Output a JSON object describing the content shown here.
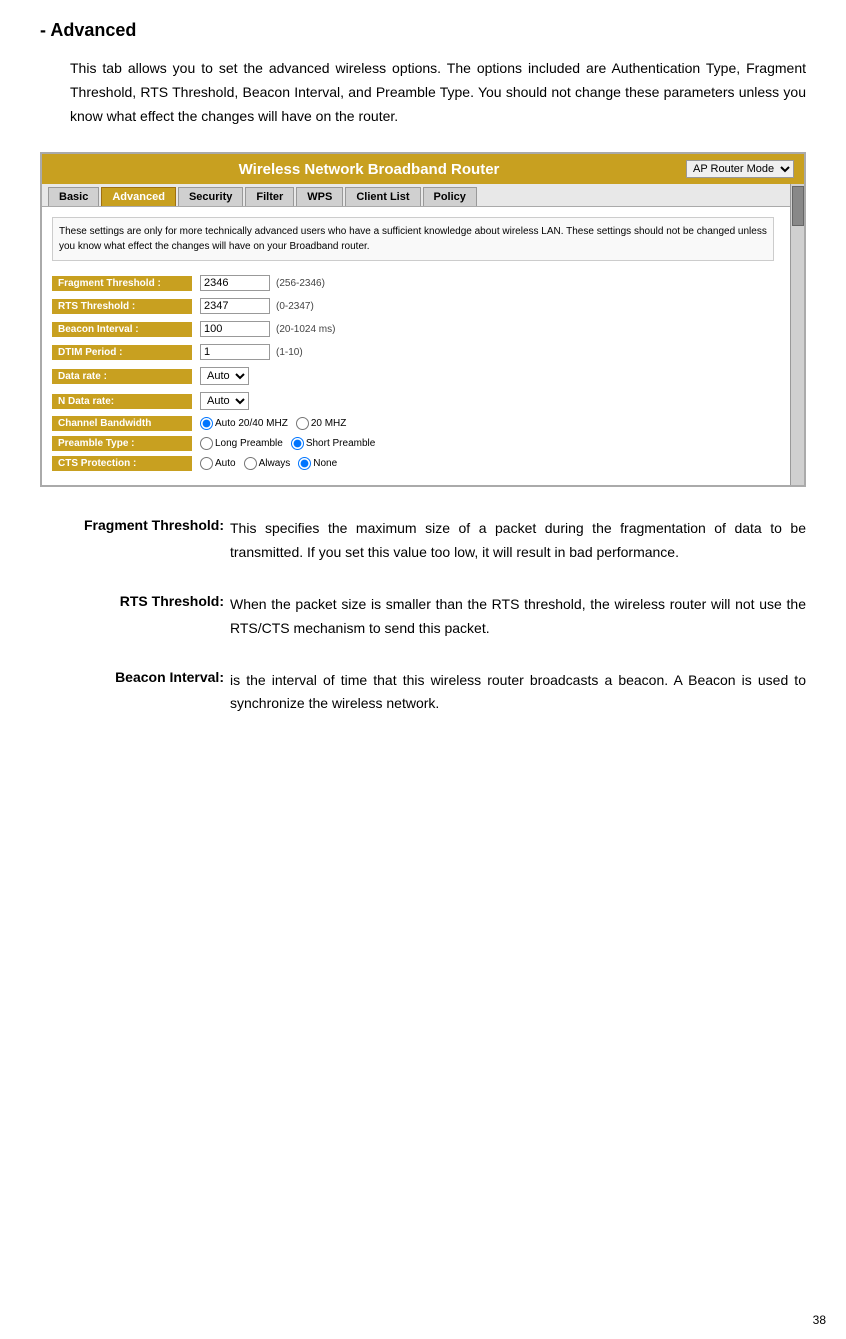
{
  "page": {
    "title": "- Advanced",
    "number": "38"
  },
  "intro": {
    "text": "This tab allows you to set the advanced wireless options. The options included are Authentication Type, Fragment Threshold, RTS Threshold, Beacon Interval, and Preamble Type. You should not change these parameters unless you know what effect the changes will have on the router."
  },
  "router_ui": {
    "header_title": "Wireless Network Broadband Router",
    "mode_label": "AP Router Mode",
    "nav_tabs": [
      {
        "label": "Basic",
        "active": false
      },
      {
        "label": "Advanced",
        "active": true
      },
      {
        "label": "Security",
        "active": false
      },
      {
        "label": "Filter",
        "active": false
      },
      {
        "label": "WPS",
        "active": false
      },
      {
        "label": "Client List",
        "active": false
      },
      {
        "label": "Policy",
        "active": false
      }
    ],
    "notice": "These settings are only for more technically advanced users who have a sufficient knowledge about wireless LAN. These settings should not be changed unless you know what effect the changes will have on your Broadband router.",
    "fields": [
      {
        "label": "Fragment Threshold :",
        "value": "2346",
        "hint": "(256-2346)",
        "type": "input"
      },
      {
        "label": "RTS Threshold :",
        "value": "2347",
        "hint": "(0-2347)",
        "type": "input"
      },
      {
        "label": "Beacon Interval :",
        "value": "100",
        "hint": "(20-1024 ms)",
        "type": "input"
      },
      {
        "label": "DTIM Period :",
        "value": "1",
        "hint": "(1-10)",
        "type": "input"
      },
      {
        "label": "Data rate :",
        "value": "Auto",
        "hint": "",
        "type": "select"
      },
      {
        "label": "N Data rate:",
        "value": "Auto",
        "hint": "",
        "type": "select"
      },
      {
        "label": "Channel Bandwidth",
        "type": "radio",
        "options": [
          {
            "label": "Auto 20/40 MHZ",
            "checked": true
          },
          {
            "label": "20 MHZ",
            "checked": false
          }
        ]
      },
      {
        "label": "Preamble Type :",
        "type": "radio",
        "options": [
          {
            "label": "Long Preamble",
            "checked": false
          },
          {
            "label": "Short Preamble",
            "checked": true
          }
        ]
      },
      {
        "label": "CTS Protection :",
        "type": "radio",
        "options": [
          {
            "label": "Auto",
            "checked": false
          },
          {
            "label": "Always",
            "checked": false
          },
          {
            "label": "None",
            "checked": true
          }
        ]
      }
    ]
  },
  "descriptions": [
    {
      "term": "Fragment Threshold:",
      "body": "This specifies the maximum size of a packet during the fragmentation of data to be transmitted. If you set this value too low, it will result in bad performance."
    },
    {
      "term": "RTS Threshold:",
      "body": "When the packet size is smaller than the RTS threshold, the wireless router will not use the RTS/CTS mechanism to send this packet."
    },
    {
      "term": "Beacon Interval:",
      "body": "is the interval of time that this wireless router broadcasts a beacon. A Beacon is used to synchronize the wireless network."
    }
  ]
}
